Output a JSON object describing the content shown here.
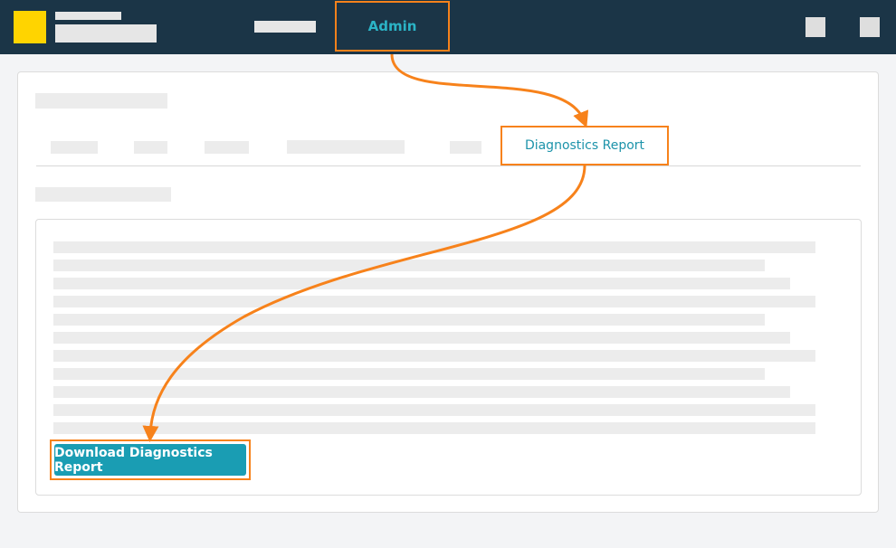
{
  "header": {
    "nav_active_label": "Admin"
  },
  "tabs": {
    "active_label": "Diagnostics Report"
  },
  "diagnostics": {
    "download_button_label": "Download Diagnostics Report"
  },
  "colors": {
    "topbar": "#1b3547",
    "logo": "#ffd400",
    "highlight": "#f7821b",
    "accent": "#1a9db3"
  },
  "icons": [
    "logo-icon",
    "top-icon-1",
    "top-icon-2"
  ]
}
